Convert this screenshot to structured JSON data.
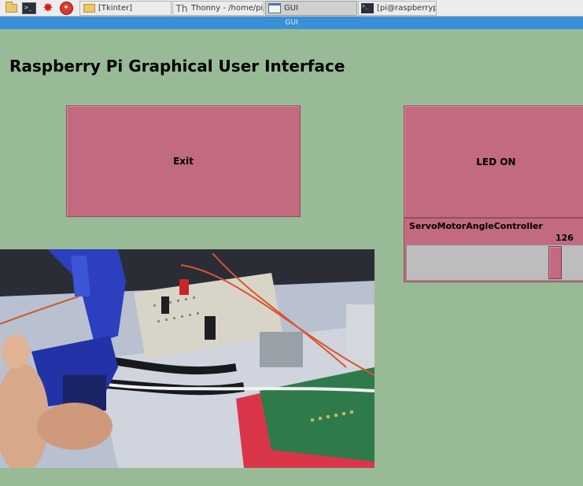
{
  "taskbar": {
    "launchers": [
      {
        "icon": "file-manager-icon"
      },
      {
        "icon": "terminal-icon",
        "glyph": ">_"
      },
      {
        "icon": "wolfram-icon",
        "glyph": "✸"
      },
      {
        "icon": "mathematica-icon",
        "glyph": "✶"
      }
    ],
    "tasks": [
      {
        "label": "[Tkinter]",
        "icon": "folder-icon",
        "active": false
      },
      {
        "label": "Thonny  -  /home/pi/...",
        "icon": "thonny-icon",
        "glyph": "Th",
        "active": false
      },
      {
        "label": "GUI",
        "icon": "window-icon",
        "active": true
      },
      {
        "label": "[pi@raspberrypi: ~]",
        "icon": "terminal-icon",
        "glyph": ">_",
        "active": false
      }
    ]
  },
  "window": {
    "title": "GUI"
  },
  "app": {
    "title": "Raspberry Pi Graphical User Interface",
    "exit_label": "Exit",
    "led_label": "LED ON",
    "servo": {
      "label": "ServoMotorAngleController",
      "value": "126",
      "fraction": 0.85
    }
  },
  "colors": {
    "background": "#98ba96",
    "button": "#c16a80",
    "titlebar": "#3a90d8",
    "trough": "#bdbdbd"
  }
}
